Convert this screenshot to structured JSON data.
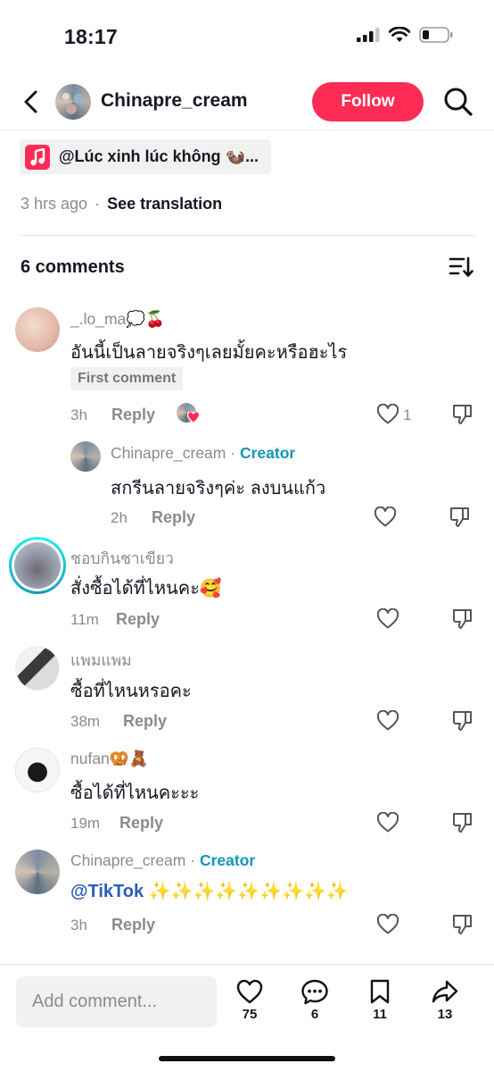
{
  "status_bar": {
    "time": "18:17"
  },
  "header": {
    "username": "Chinapre_cream",
    "follow_label": "Follow"
  },
  "music": {
    "label": "@Lúc xinh lúc không 🦦..."
  },
  "meta": {
    "time_ago": "3 hrs ago",
    "separator": "·",
    "see_translation": "See translation"
  },
  "comments_header": {
    "count_label": "6 comments"
  },
  "comments": [
    {
      "username": "_.lo_ma💭🍒",
      "text": "อันนี้เป็นลายจริงๆเลยมั้ยคะหรือฮะไร",
      "badge": "First comment",
      "time": "3h",
      "reply": "Reply",
      "likes": "1"
    },
    {
      "username": "Chinapre_cream",
      "creator": "Creator",
      "sep": "·",
      "text": "สกรีนลายจริงๆค่ะ ลงบนแก้ว",
      "time": "2h",
      "reply": "Reply"
    },
    {
      "username": "ชอบกินชาเขียว",
      "text": "สั่งซื้อได้ที่ไหนคะ🥰",
      "time": "11m",
      "reply": "Reply"
    },
    {
      "username": "แพมแพม",
      "text": "ซื้อที่ไหนหรอคะ",
      "time": "38m",
      "reply": "Reply"
    },
    {
      "username": "nufan🥨🧸",
      "text": "ซื้อได้ที่ไหนคะะะ",
      "time": "19m",
      "reply": "Reply"
    },
    {
      "username": "Chinapre_cream",
      "creator": "Creator",
      "sep": "·",
      "mention": "@TikTok",
      "text": " ✨✨✨✨✨✨✨✨✨",
      "time": "3h",
      "reply": "Reply"
    }
  ],
  "bottom_bar": {
    "placeholder": "Add comment...",
    "likes": "75",
    "comments": "6",
    "saves": "11",
    "shares": "13"
  },
  "colors": {
    "accent": "#fe2c55",
    "creator": "#1296b8",
    "mention": "#2b5db9"
  }
}
